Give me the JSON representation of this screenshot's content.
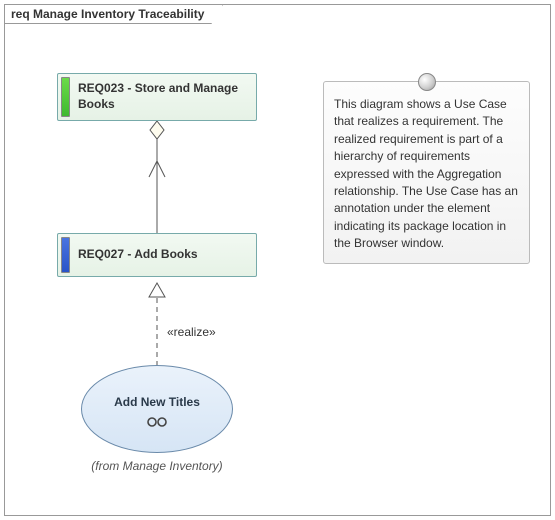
{
  "diagram": {
    "title": "req Manage Inventory Traceability",
    "type": "requirement",
    "relationships": [
      {
        "from": "REQ027",
        "to": "REQ023",
        "kind": "aggregation"
      },
      {
        "from": "UC_AddNewTitles",
        "to": "REQ027",
        "kind": "realize",
        "label": "«realize»"
      }
    ]
  },
  "requirements": {
    "req023": {
      "id": "REQ023",
      "label": "REQ023 - Store and Manage Books",
      "stripe_color": "#3fb92f"
    },
    "req027": {
      "id": "REQ027",
      "label": "REQ027 - Add Books",
      "stripe_color": "#2a54c8"
    }
  },
  "usecase": {
    "id": "UC_AddNewTitles",
    "label": "Add New Titles",
    "from_package": "(from Manage Inventory)"
  },
  "connector": {
    "realize_label": "«realize»"
  },
  "note": {
    "text": "This diagram shows a Use Case that realizes a requirement. The realized requirement is part of a hierarchy of requirements expressed with the Aggregation relationship. The Use Case has an annotation under the element indicating its package location in the Browser window."
  }
}
